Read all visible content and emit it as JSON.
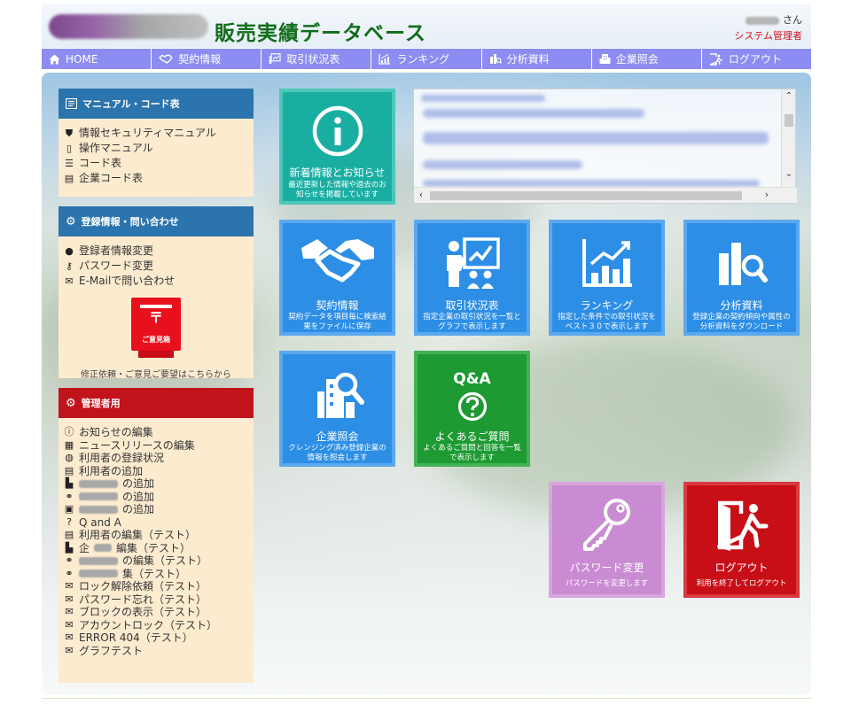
{
  "header": {
    "app_title": "販売実績データベース",
    "user_suffix": "さん",
    "user_role": "システム管理者"
  },
  "nav": [
    {
      "label": "HOME",
      "icon": "home-icon"
    },
    {
      "label": "契約情報",
      "icon": "handshake-icon"
    },
    {
      "label": "取引状況表",
      "icon": "presentation-icon"
    },
    {
      "label": "ランキング",
      "icon": "chart-up-icon"
    },
    {
      "label": "分析資料",
      "icon": "analysis-icon"
    },
    {
      "label": "企業照会",
      "icon": "building-icon"
    },
    {
      "label": "ログアウト",
      "icon": "logout-icon"
    }
  ],
  "sidebar": {
    "manual": {
      "title": "マニュアル・コード表",
      "items": [
        "情報セキュリティマニュアル",
        "操作マニュアル",
        "コード表",
        "企業コード表"
      ]
    },
    "registration": {
      "title": "登録情報・問い合わせ",
      "items": [
        "登録者情報変更",
        "パスワード変更",
        "E-Mailで問い合わせ"
      ],
      "mailbox_mark": "〒",
      "mailbox_label": "ご意見箱",
      "feedback_note": "修正依頼・ご意見ご要望はこちらから"
    },
    "admin": {
      "title": "管理者用",
      "items": {
        "i0": "お知らせの編集",
        "i1": "ニュースリリースの編集",
        "i2": "利用者の登録状況",
        "i3": "利用者の追加",
        "i4": "の追加",
        "i5": "の追加",
        "i6": "の追加",
        "i7": "Q and A",
        "i8": "利用者の編集（テスト）",
        "i9": "編集（テスト）",
        "i10": "の編集（テスト）",
        "i11": "集（テスト）",
        "i12": "ロック解除依頼（テスト）",
        "i13": "パスワード忘れ（テスト）",
        "i14": "ブロックの表示（テスト）",
        "i15": "アカウントロック（テスト）",
        "i16": "ERROR 404（テスト）",
        "i17": "グラフテスト"
      },
      "i9_prefix": "企"
    }
  },
  "tiles": {
    "news": {
      "title": "新着情報とお知らせ",
      "desc": "最近更新した情報や過去のお知らせを掲載しています"
    },
    "contract": {
      "title": "契約情報",
      "desc": "契約データを項目毎に検索結果をファイルに保存"
    },
    "trade": {
      "title": "取引状況表",
      "desc": "指定企業の取引状況を一覧とグラフで表示します"
    },
    "ranking": {
      "title": "ランキング",
      "desc": "指定した条件での取引状況をベスト３０で表示します"
    },
    "analysis": {
      "title": "分析資料",
      "desc": "登録企業の契約傾向や属性の分析資料をダウンロード"
    },
    "company": {
      "title": "企業照会",
      "desc": "クレンジング済み登録企業の情報を照会します"
    },
    "faq": {
      "title": "よくあるご質問",
      "badge": "Q&A",
      "desc": "よくあるご質問と回答を一覧で表示します"
    },
    "password": {
      "title": "パスワード変更",
      "desc": "パスワードを変更します"
    },
    "logout": {
      "title": "ログアウト",
      "desc": "利用を終了してログアウト"
    }
  },
  "colors": {
    "nav": "#8c8cf2",
    "title_green": "#116d1a",
    "role_red": "#d0101e",
    "teal": "#1aaea3",
    "blue": "#2d8ee6",
    "green": "#1e9a33",
    "purple": "#c98bd1",
    "red": "#c80e17"
  }
}
